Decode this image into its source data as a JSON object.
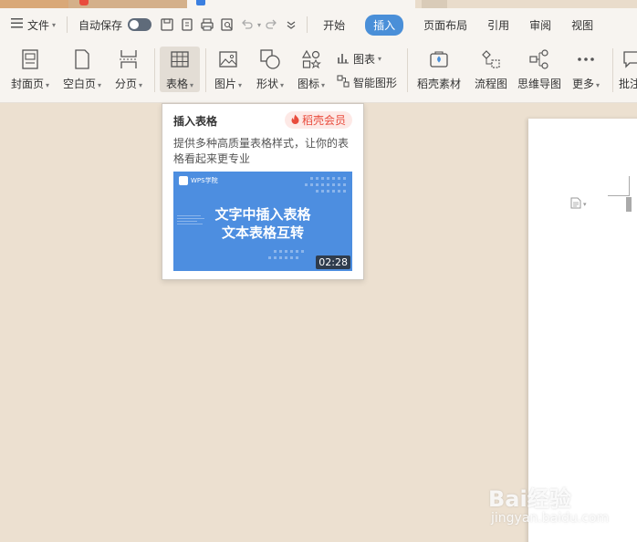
{
  "menubar": {
    "file_label": "文件",
    "autosave_label": "自动保存",
    "tabs": [
      {
        "label": "开始"
      },
      {
        "label": "插入"
      },
      {
        "label": "页面布局"
      },
      {
        "label": "引用"
      },
      {
        "label": "审阅"
      },
      {
        "label": "视图"
      }
    ]
  },
  "ribbon": {
    "cover_page": "封面页",
    "blank_page": "空白页",
    "page_break": "分页",
    "table": "表格",
    "picture": "图片",
    "shape": "形状",
    "icon": "图标",
    "chart": "图表",
    "smart_art": "智能图形",
    "daoke_material": "稻壳素材",
    "flowchart": "流程图",
    "mindmap": "思维导图",
    "more": "更多",
    "annotate": "批注"
  },
  "popup": {
    "title": "插入表格",
    "badge": "稻壳会员",
    "description": "提供多种高质量表格样式，让你的表格看起来更专业",
    "thumb_logo": "WPS学院",
    "thumb_line1": "文字中插入表格",
    "thumb_line2": "文本表格互转",
    "duration": "02:28"
  },
  "watermark": {
    "brand": "Bai经验",
    "url": "jingyan.baidu.com"
  },
  "colors": {
    "accent": "#4a8fd8",
    "vip": "#e94b3c",
    "background": "#ece0d0"
  }
}
